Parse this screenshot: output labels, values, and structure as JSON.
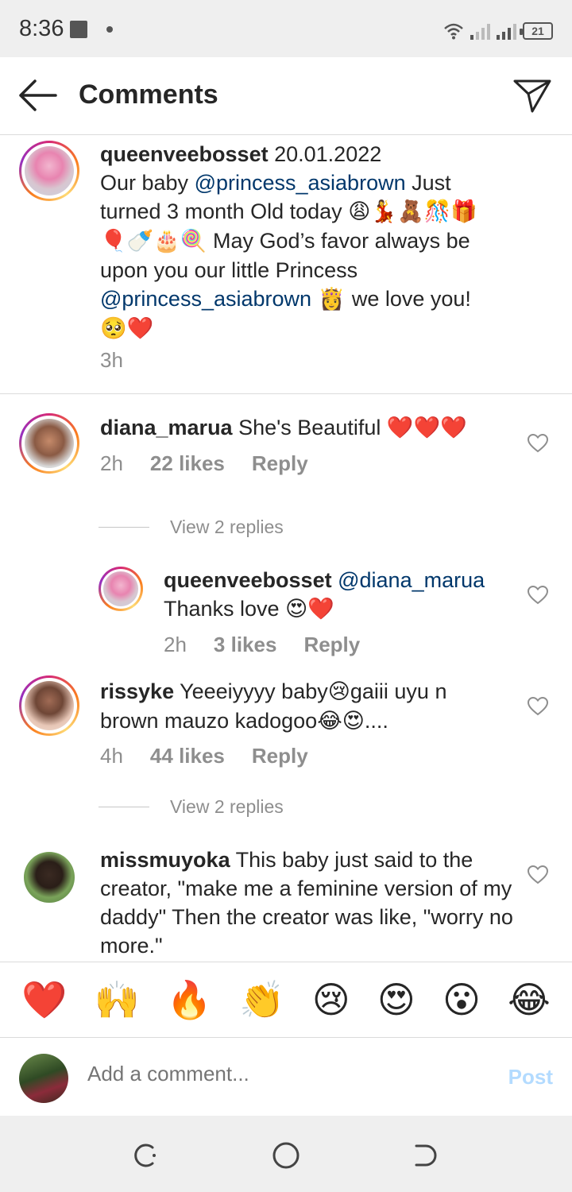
{
  "status_bar": {
    "time": "8:36",
    "battery": "21"
  },
  "header": {
    "title": "Comments"
  },
  "caption": {
    "username": "queenveebosset",
    "date": "20.01.2022",
    "text_1": "Our baby ",
    "mention_1": "@princess_asiabrown",
    "text_2": " Just turned 3 month Old today",
    "emojis_1": "😩💃🧸🎊🎁🎈🍼🎂🍭",
    "text_3": " May God’s favor always be upon you our little Princess ",
    "mention_2": "@princess_asiabrown",
    "emojis_2": " 👸 ",
    "text_4": "we love you! ",
    "emojis_3": "🥺❤️",
    "time": "3h"
  },
  "comments": [
    {
      "username": "diana_marua",
      "text": " She's Beautiful ",
      "emojis": "❤️❤️❤️",
      "time": "2h",
      "likes": "22 likes",
      "reply": "Reply",
      "view_replies": "View 2 replies"
    },
    {
      "username": "queenveebosset",
      "mention": "@diana_marua",
      "text": "Thanks love ",
      "emojis": "😍❤️",
      "time": "2h",
      "likes": "3 likes",
      "reply": "Reply"
    },
    {
      "username": "rissyke",
      "text_1": " Yeeeiyyyy baby",
      "emoji_1": "😢",
      "text_2": "gaiii uyu n brown mauzo kadogoo",
      "emoji_2": "😂😍",
      "text_3": "....",
      "time": "4h",
      "likes": "44 likes",
      "reply": "Reply",
      "view_replies": "View 2 replies"
    },
    {
      "username": "missmuyoka",
      "text": " This baby just said to the creator, \"make me a feminine version of my daddy\" Then the creator was like, \"worry no more.\""
    }
  ],
  "reactions": [
    "❤️",
    "🙌",
    "🔥",
    "👏",
    "😢",
    "😍",
    "😮",
    "😂"
  ],
  "add_comment": {
    "placeholder": "Add a comment...",
    "post_label": "Post"
  },
  "colors": {
    "mention": "#00376b",
    "post_disabled": "#b3dbff",
    "muted": "#8e8e8e"
  }
}
